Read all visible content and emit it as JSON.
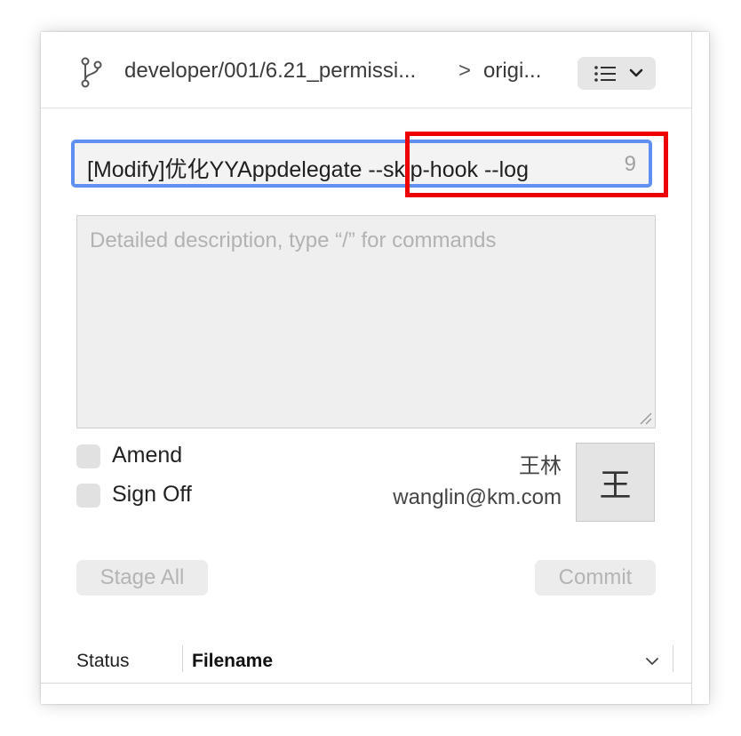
{
  "topbar": {
    "branch": "developer/001/6.21_permissi...",
    "separator": ">",
    "remote": "origi...",
    "branch_icon": "git-branch-icon",
    "menu_icon": "list-icon"
  },
  "summary": {
    "text": "[Modify]优化YYAppdelegate --skip-hook --log",
    "remaining_count": "9",
    "highlight_color": "#ee0000",
    "focus_color": "#5f8ff0"
  },
  "description": {
    "placeholder": "Detailed description, type “/” for commands"
  },
  "options": {
    "amend_label": "Amend",
    "amend_checked": false,
    "signoff_label": "Sign Off",
    "signoff_checked": false
  },
  "author": {
    "name": "王林",
    "email": "wanglin@km.com",
    "avatar_initial": "王"
  },
  "actions": {
    "stage_all_label": "Stage All",
    "commit_label": "Commit"
  },
  "table": {
    "columns": [
      "Status",
      "Filename"
    ]
  }
}
